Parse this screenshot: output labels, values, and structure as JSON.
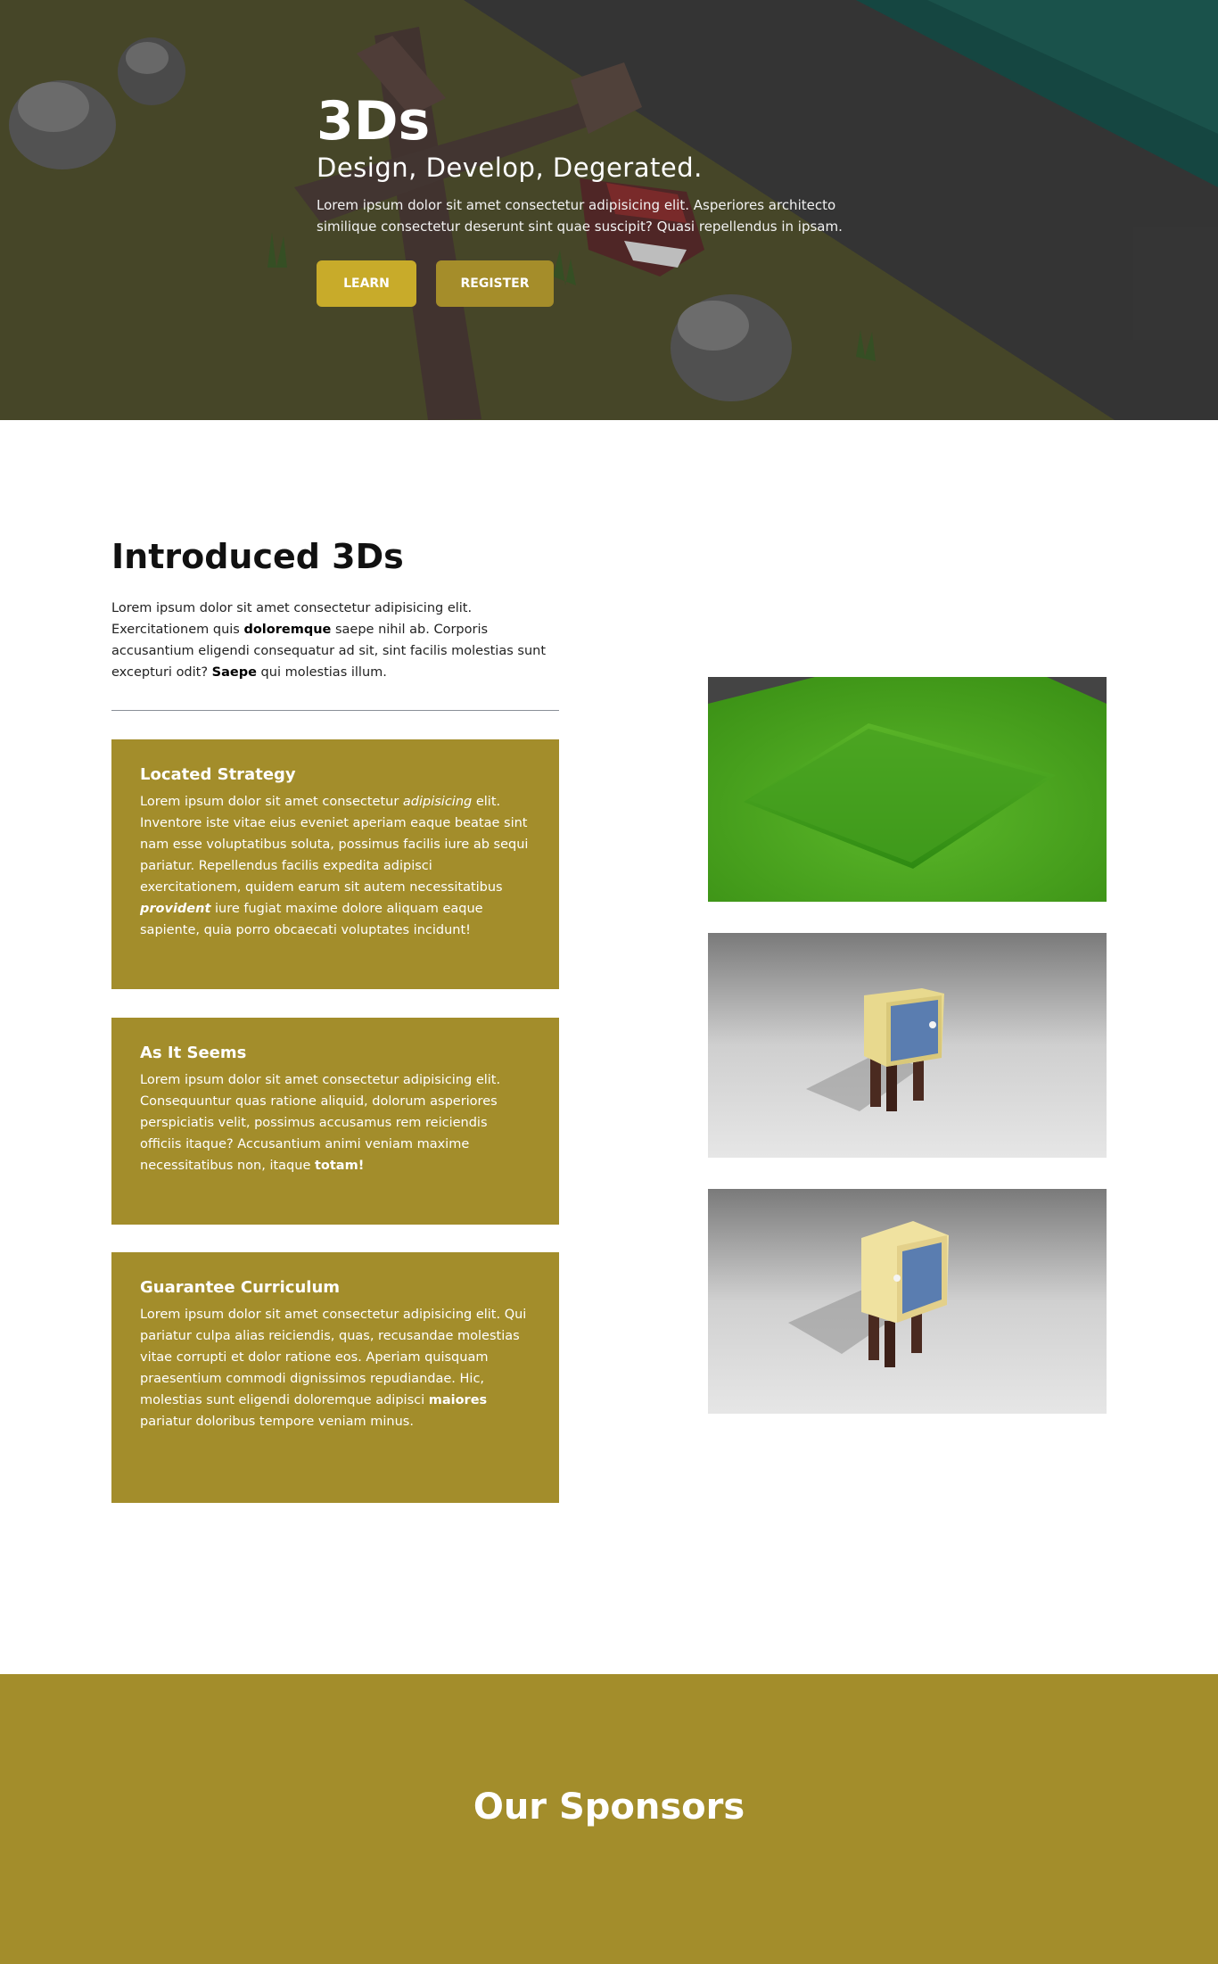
{
  "hero": {
    "title": "3Ds",
    "subtitle": "Design, Develop, Degerated.",
    "text": "Lorem ipsum dolor sit amet consectetur adipisicing elit. Asperiores architecto similique consectetur deserunt sint quae suscipit? Quasi repellendus in ipsam.",
    "learn_label": "LEARN",
    "register_label": "REGISTER"
  },
  "intro": {
    "title": "Introduced 3Ds",
    "text_parts": [
      "Lorem ipsum dolor sit amet consectetur adipisicing elit. Exercitationem quis ",
      "doloremque",
      " saepe nihil ab. Corporis accusantium eligendi consequatur ad sit, sint facilis molestias sunt excepturi odit? ",
      "Saepe",
      " qui molestias illum."
    ]
  },
  "cards": [
    {
      "title": "Located Strategy",
      "parts": [
        "Lorem ipsum dolor sit amet consectetur ",
        "adipisicing",
        " elit. Inventore iste vitae eius eveniet aperiam eaque beatae sint nam esse voluptatibus soluta, possimus facilis iure ab sequi pariatur. Repellendus facilis expedita adipisci exercitationem, quidem earum sit autem necessitatibus ",
        "provident",
        " iure fugiat maxime dolore aliquam eaque sapiente, quia porro obcaecati voluptates incidunt!"
      ]
    },
    {
      "title": "As It Seems",
      "parts": [
        "Lorem ipsum dolor sit amet consectetur adipisicing elit. Consequuntur quas ratione aliquid, dolorum asperiores perspiciatis velit, possimus accusamus rem reiciendis officiis itaque? Accusantium animi veniam maxime necessitatibus non, itaque ",
        "totam!"
      ]
    },
    {
      "title": "Guarantee Curriculum",
      "parts": [
        "Lorem ipsum dolor sit amet consectetur adipisicing elit. Qui pariatur culpa alias reiciendis, quas, recusandae molestias vitae corrupti et dolor ratione eos. Aperiam quisquam praesentium commodi dignissimos repudiandae. Hic, molestias sunt eligendi doloremque adipisci ",
        "maiores",
        " pariatur doloribus tempore veniam minus."
      ]
    }
  ],
  "sponsors": {
    "title": "Our Sponsors"
  },
  "colors": {
    "accent": "#a38d2b",
    "learn_button": "#c8ab2a",
    "register_button": "#a58d2a",
    "hero_dark": "#3b3b3b"
  },
  "images": [
    "grass-render",
    "cabinet-render-blue",
    "cabinet-render-yellow"
  ]
}
